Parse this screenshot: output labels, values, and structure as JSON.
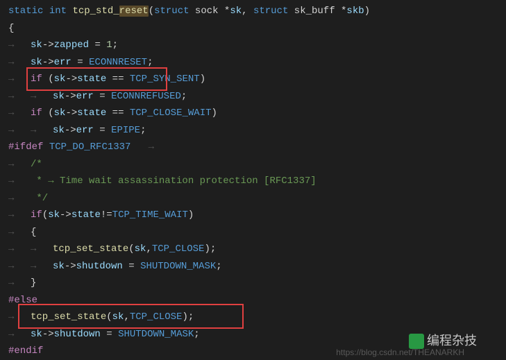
{
  "code": {
    "sig": {
      "static": "static",
      "int": "int",
      "fn": "tcp_std_reset",
      "struct1": "struct",
      "sock": "sock",
      "arg1": "sk",
      "struct2": "struct",
      "skbuff": "sk_buff",
      "arg2": "skb"
    },
    "sel_token": "reset",
    "brace_open": "{",
    "l1": {
      "sk": "sk",
      "arrow": "->",
      "zapped": "zapped",
      "eq": " = ",
      "one": "1"
    },
    "l2": {
      "sk": "sk",
      "arrow": "->",
      "err": "err",
      "eq": " = ",
      "econn": "ECONNRESET"
    },
    "l3": {
      "if": "if",
      "sk": "sk",
      "arrow": "->",
      "state": "state",
      "eqeq": " == ",
      "syn": "TCP_SYN_SENT"
    },
    "l4": {
      "sk": "sk",
      "arrow": "->",
      "err": "err",
      "eq": " = ",
      "eref": "ECONNREFUSED"
    },
    "l5": {
      "if": "if",
      "sk": "sk",
      "arrow": "->",
      "state": "state",
      "eqeq": " == ",
      "cw": "TCP_CLOSE_WAIT"
    },
    "l6": {
      "sk": "sk",
      "arrow": "->",
      "err": "err",
      "eq": " = ",
      "epipe": "EPIPE"
    },
    "ifdef": {
      "pre": "#ifdef",
      "name": "TCP_DO_RFC1337"
    },
    "c1": "/*",
    "c2": " * → Time wait assassination protection [RFC1337]",
    "c3": " */",
    "l7": {
      "if": "if",
      "sk": "sk",
      "arrow": "->",
      "state": "state",
      "ne": "!=",
      "tw": "TCP_TIME_WAIT"
    },
    "brace_open2": "{",
    "l8": {
      "fn": "tcp_set_state",
      "sk": "sk",
      "close": "TCP_CLOSE"
    },
    "l9": {
      "sk": "sk",
      "arrow": "->",
      "sd": "shutdown",
      "eq": " = ",
      "mask": "SHUTDOWN_MASK"
    },
    "brace_close2": "}",
    "else": "#else",
    "l10": {
      "fn": "tcp_set_state",
      "sk": "sk",
      "close": "TCP_CLOSE"
    },
    "l11": {
      "sk": "sk",
      "arrow": "->",
      "sd": "shutdown",
      "eq": " = ",
      "mask": "SHUTDOWN_MASK"
    },
    "endif": "#endif"
  },
  "watermark": {
    "label": "编程杂技",
    "url": "https://blog.csdn.net/THEANARKH"
  }
}
